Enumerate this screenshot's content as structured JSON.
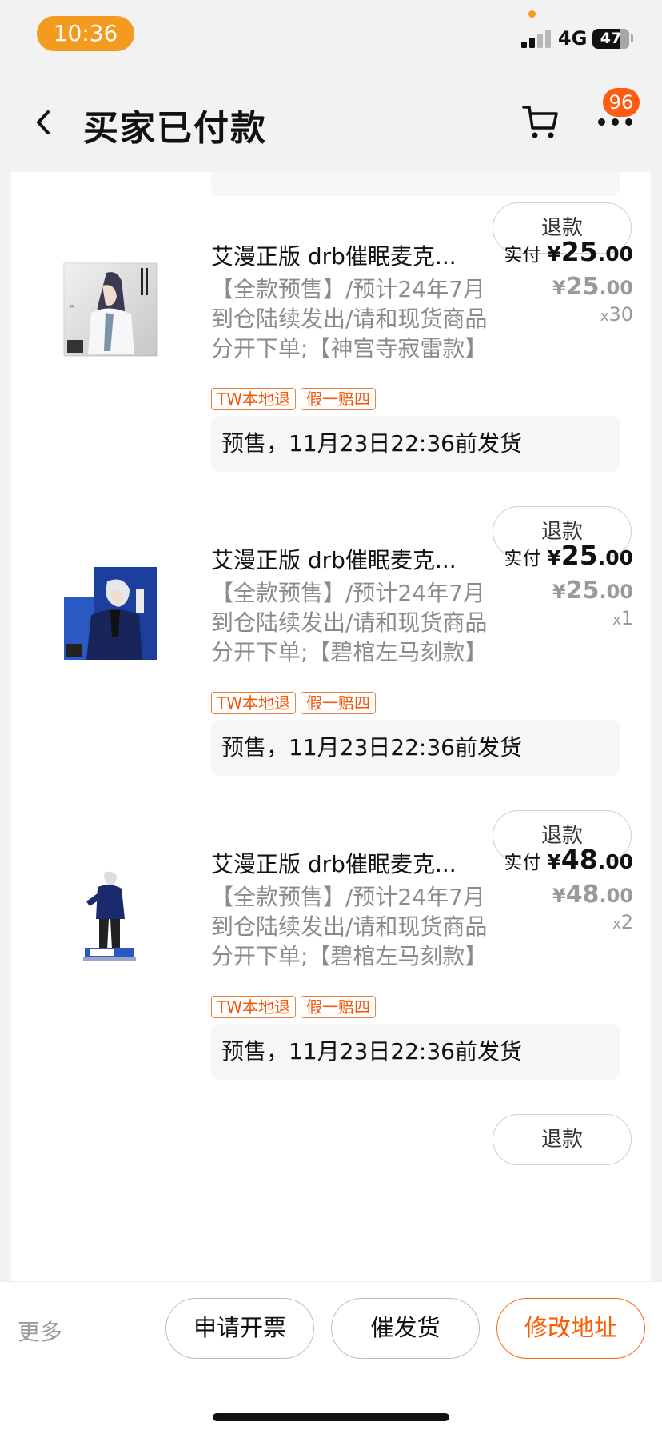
{
  "status_bar": {
    "time": "10:36",
    "network": "4G",
    "battery": "47"
  },
  "nav": {
    "title": "买家已付款",
    "badge_count": "96"
  },
  "colors": {
    "accent": "#ff5a00",
    "time_pill": "#f39a1f",
    "badge": "#ff5b12",
    "tag": "#f05a10"
  },
  "items": [
    {
      "refund_label": "退款",
      "title": "艾漫正版 drb催眠麦克...",
      "description": "【全款预售】/预计24年7月到仓陆续发出/请和现货商品分开下单;【神宫寺寂雷款】",
      "paid_label": "实付",
      "currency": "¥",
      "paid_int": "25",
      "paid_dec": ".00",
      "orig_int": "25",
      "orig_dec": ".00",
      "qty_prefix": "x",
      "qty": "30",
      "tags": [
        "TW本地退",
        "假一赔四"
      ],
      "shipping": "预售，11月23日22:36前发货",
      "thumb_icon": "shinjuku-jakurai-acrylic-art"
    },
    {
      "refund_label": "退款",
      "title": "艾漫正版 drb催眠麦克...",
      "description": "【全款预售】/预计24年7月到仓陆续发出/请和现货商品分开下单;【碧棺左马刻款】",
      "paid_label": "实付",
      "currency": "¥",
      "paid_int": "25",
      "paid_dec": ".00",
      "orig_int": "25",
      "orig_dec": ".00",
      "qty_prefix": "x",
      "qty": "1",
      "tags": [
        "TW本地退",
        "假一赔四"
      ],
      "shipping": "预售，11月23日22:36前发货",
      "thumb_icon": "yokohama-samatoki-acrylic-art"
    },
    {
      "refund_label": "退款",
      "title": "艾漫正版 drb催眠麦克...",
      "description": "【全款预售】/预计24年7月到仓陆续发出/请和现货商品分开下单;【碧棺左马刻款】",
      "paid_label": "实付",
      "currency": "¥",
      "paid_int": "48",
      "paid_dec": ".00",
      "orig_int": "48",
      "orig_dec": ".00",
      "qty_prefix": "x",
      "qty": "2",
      "tags": [
        "TW本地退",
        "假一赔四"
      ],
      "shipping": "预售，11月23日22:36前发货",
      "thumb_icon": "samatoki-acrylic-stand"
    }
  ],
  "next_refund_label": "退款",
  "bottom_bar": {
    "more": "更多",
    "invoice": "申请开票",
    "urge": "催发货",
    "change_address": "修改地址"
  }
}
